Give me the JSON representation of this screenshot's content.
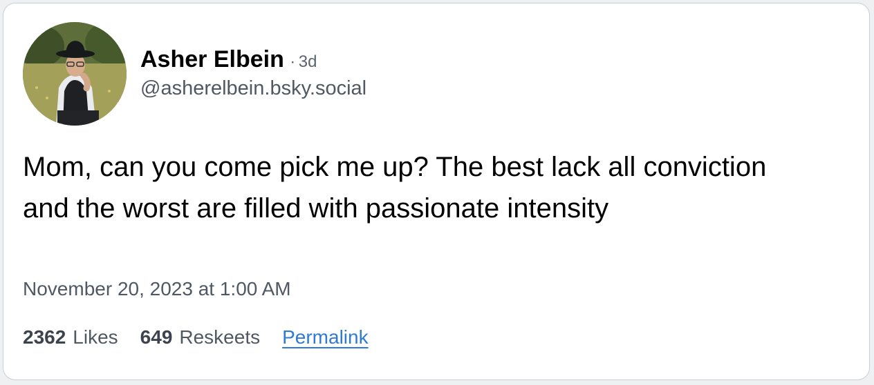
{
  "post": {
    "author": {
      "display_name": "Asher Elbein",
      "separator": "·",
      "age": "3d",
      "handle": "@asherelbein.bsky.social"
    },
    "text": "Mom, can you come pick me up? The best lack all conviction and the worst are filled with passionate intensity",
    "timestamp": "November 20, 2023 at 1:00 AM",
    "likes": {
      "count": "2362",
      "label": "Likes"
    },
    "reskeets": {
      "count": "649",
      "label": "Reskeets"
    },
    "permalink_label": "Permalink"
  },
  "colors": {
    "link": "#2e7ad6",
    "muted_text": "#4f5863",
    "border": "#c9ced4"
  }
}
